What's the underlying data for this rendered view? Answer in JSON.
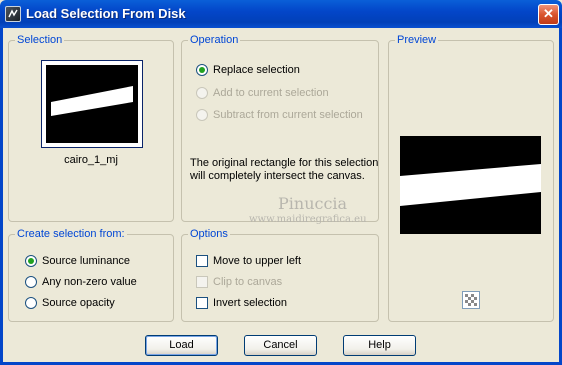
{
  "window": {
    "title": "Load Selection From Disk",
    "close_symbol": "✕"
  },
  "selection_group": {
    "label": "Selection",
    "thumbnail_name": "cairo_1_mj"
  },
  "operation_group": {
    "label": "Operation",
    "options": [
      {
        "label": "Replace selection",
        "selected": true,
        "enabled": true
      },
      {
        "label": "Add to current selection",
        "selected": false,
        "enabled": false
      },
      {
        "label": "Subtract from current selection",
        "selected": false,
        "enabled": false
      }
    ],
    "message_line1": "The original rectangle for this selection",
    "message_line2": "will completely intersect the canvas."
  },
  "preview_group": {
    "label": "Preview"
  },
  "create_group": {
    "label": "Create selection from:",
    "options": [
      {
        "label": "Source luminance",
        "selected": true
      },
      {
        "label": "Any non-zero value",
        "selected": false
      },
      {
        "label": "Source opacity",
        "selected": false
      }
    ]
  },
  "options_group": {
    "label": "Options",
    "items": [
      {
        "label": "Move to upper left",
        "checked": false,
        "enabled": true
      },
      {
        "label": "Clip to canvas",
        "checked": false,
        "enabled": false
      },
      {
        "label": "Invert selection",
        "checked": false,
        "enabled": true
      }
    ]
  },
  "buttons": {
    "load": "Load",
    "cancel": "Cancel",
    "help": "Help"
  },
  "watermark": {
    "name": "Pinuccia",
    "url": "www.maidiregrafica.eu"
  },
  "colors": {
    "title_bar": "#0346c9",
    "group_label": "#0046d5",
    "dialog_bg": "#ece9d8"
  }
}
